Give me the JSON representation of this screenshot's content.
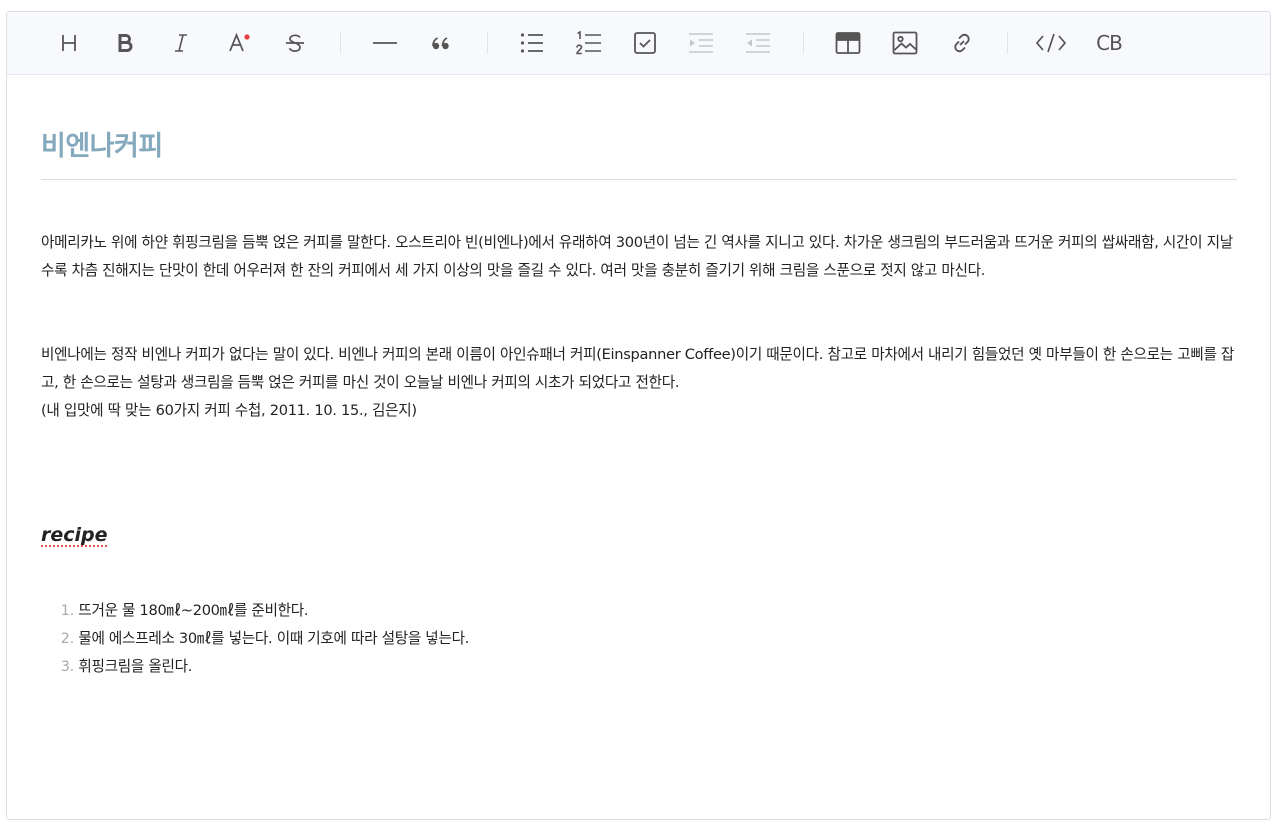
{
  "toolbar": {
    "buttons": [
      {
        "name": "heading-icon",
        "tooltip": "Headings"
      },
      {
        "name": "bold-icon",
        "tooltip": "Bold"
      },
      {
        "name": "italic-icon",
        "tooltip": "Italic"
      },
      {
        "name": "text-color-icon",
        "tooltip": "Text color"
      },
      {
        "name": "strikethrough-icon",
        "tooltip": "Strike"
      },
      {
        "name": "horizontal-line-icon",
        "tooltip": "Line"
      },
      {
        "name": "blockquote-icon",
        "tooltip": "Blockquote"
      },
      {
        "name": "bullet-list-icon",
        "tooltip": "Unordered list"
      },
      {
        "name": "ordered-list-icon",
        "tooltip": "Ordered list"
      },
      {
        "name": "task-list-icon",
        "tooltip": "Task"
      },
      {
        "name": "indent-icon",
        "tooltip": "Indent",
        "disabled": true
      },
      {
        "name": "outdent-icon",
        "tooltip": "Outdent",
        "disabled": true
      },
      {
        "name": "table-icon",
        "tooltip": "Insert table"
      },
      {
        "name": "image-icon",
        "tooltip": "Insert image"
      },
      {
        "name": "link-icon",
        "tooltip": "Insert link"
      },
      {
        "name": "code-icon",
        "tooltip": "Code"
      },
      {
        "name": "code-block-icon",
        "tooltip": "Insert CodeBlock"
      }
    ],
    "code_block_label": "CB",
    "accent_dot_color": "#e8403d"
  },
  "document": {
    "title": "비엔나커피",
    "paragraph1": "아메리카노 위에 하얀 휘핑크림을 듬뿍 얹은 커피를 말한다. 오스트리아 빈(비엔나)에서 유래하여 300년이 넘는 긴 역사를 지니고 있다. 차가운 생크림의 부드러움과 뜨거운 커피의 쌉싸래함, 시간이 지날수록 차츰 진해지는 단맛이 한데 어우러져 한 잔의 커피에서 세 가지 이상의 맛을 즐길 수 있다. 여러 맛을 충분히 즐기기 위해 크림을 스푼으로 젓지 않고 마신다.",
    "paragraph2": "비엔나에는 정작 비엔나 커피가 없다는 말이 있다. 비엔나 커피의 본래 이름이 아인슈패너 커피(Einspanner Coffee)이기 때문이다. 참고로 마차에서 내리기 힘들었던 옛 마부들이 한 손으로는 고삐를 잡고, 한 손으로는 설탕과 생크림을 듬뿍 얹은 커피를 마신 것이 오늘날 비엔나 커피의 시초가 되었다고 전한다.\n(내 입맛에 딱 맞는 60가지 커피 수첩, 2011. 10. 15., 김은지)",
    "recipe_heading": "recipe",
    "steps": [
      {
        "num": "1.",
        "text": "뜨거운 물 180㎖~200㎖를 준비한다."
      },
      {
        "num": "2.",
        "text": "물에 에스프레소 30㎖를 넣는다. 이때 기호에 따라 설탕을 넣는다."
      },
      {
        "num": "3.",
        "text": "휘핑크림을 올린다."
      }
    ]
  }
}
